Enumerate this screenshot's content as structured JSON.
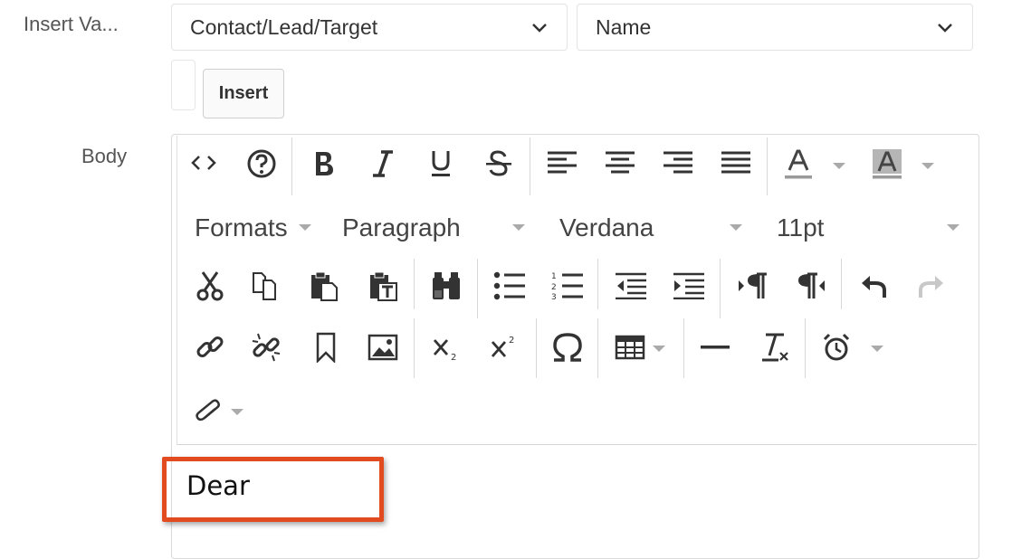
{
  "form": {
    "insert_variable_label": "Insert Va...",
    "module_select_value": "Contact/Lead/Target",
    "field_select_value": "Name",
    "insert_button_label": "Insert",
    "body_label": "Body"
  },
  "toolbar": {
    "formats_label": "Formats",
    "block_format_value": "Paragraph",
    "font_family_value": "Verdana",
    "font_size_value": "11pt",
    "row1_icons": [
      "source-code-icon",
      "help-icon",
      "bold-icon",
      "italic-icon",
      "underline-icon",
      "strikethrough-icon",
      "align-left-icon",
      "align-center-icon",
      "align-right-icon",
      "align-justify-icon",
      "text-color-icon",
      "background-color-icon"
    ],
    "row3_icons": [
      "cut-icon",
      "copy-icon",
      "paste-icon",
      "paste-text-icon",
      "find-replace-icon",
      "bullet-list-icon",
      "numbered-list-icon",
      "outdent-icon",
      "indent-icon",
      "ltr-icon",
      "rtl-icon",
      "undo-icon",
      "redo-icon"
    ],
    "row4_icons": [
      "link-icon",
      "unlink-icon",
      "anchor-icon",
      "image-icon",
      "subscript-icon",
      "superscript-icon",
      "special-char-icon",
      "table-icon",
      "horizontal-rule-icon",
      "remove-format-icon",
      "insert-time-icon"
    ],
    "row5_icons": [
      "attachment-icon"
    ]
  },
  "editor": {
    "content_text": "Dear"
  },
  "colors": {
    "highlight_border": "#e24a1f",
    "icon_color": "#333333",
    "caret_color": "#aaaaaa"
  }
}
